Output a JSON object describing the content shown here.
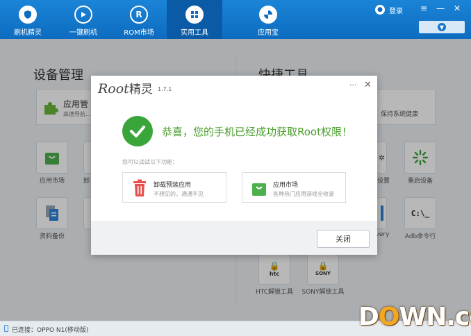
{
  "nav": {
    "items": [
      {
        "label": "刷机精灵",
        "icon": "shield-icon"
      },
      {
        "label": "一键刷机",
        "icon": "play-icon"
      },
      {
        "label": "ROM市场",
        "icon": "rom-icon"
      },
      {
        "label": "实用工具",
        "icon": "grid-icon"
      },
      {
        "label": "应用宝",
        "icon": "app-treasure-icon"
      }
    ],
    "active_index": 3,
    "login_label": "登录"
  },
  "left_panel": {
    "title": "设备管理",
    "card": {
      "title": "应用管",
      "subtitle": "高德导航..."
    },
    "tiles": [
      {
        "label": "应用市场",
        "icon": "app-market-icon"
      },
      {
        "label": "卸",
        "icon": "uninstall-icon"
      },
      {
        "label": "资料备份",
        "icon": "backup-icon"
      },
      {
        "label": "",
        "icon": "partial-icon"
      }
    ]
  },
  "right_panel": {
    "title": "快捷工具",
    "card": {
      "subtitle": "保持系统健康"
    },
    "tiles": [
      {
        "label": "设置",
        "icon": "settings-icon"
      },
      {
        "label": "重启设备",
        "icon": "reboot-icon"
      },
      {
        "label": "overy",
        "icon": "recovery-icon"
      },
      {
        "label": "Adb命令行",
        "icon": "adb-icon",
        "glyph": "C:\\_"
      },
      {
        "label": "HTC解锁工具",
        "icon": "htc-unlock-icon",
        "glyph": "htc"
      },
      {
        "label": "SONY解锁工具",
        "icon": "sony-unlock-icon",
        "glyph": "SONY"
      }
    ]
  },
  "dialog": {
    "logo_text": "Root",
    "logo_zh": "精灵",
    "version": "1.7.1",
    "more_glyph": "···",
    "close_glyph": "✕",
    "success_message": "恭喜，您的手机已经成功获取Root权限！",
    "hint": "您可以试试以下功能：",
    "features": [
      {
        "title": "卸载预装应用",
        "subtitle": "不想见的，通通不见",
        "icon": "trash-icon"
      },
      {
        "title": "应用市场",
        "subtitle": "各种热门应用游戏全收录",
        "icon": "shopping-bag-icon"
      }
    ],
    "close_button": "关闭"
  },
  "status": {
    "text": "已连接：OPPO N1(移动版)"
  },
  "watermark": {
    "text_a": "D",
    "text_o": "O",
    "text_b": "WN.cc"
  },
  "colors": {
    "topbar": "#1479cc",
    "success_green": "#3aa53a",
    "success_text": "#4a9e2b",
    "trash_red": "#e8514b",
    "market_green": "#4cb04c"
  }
}
